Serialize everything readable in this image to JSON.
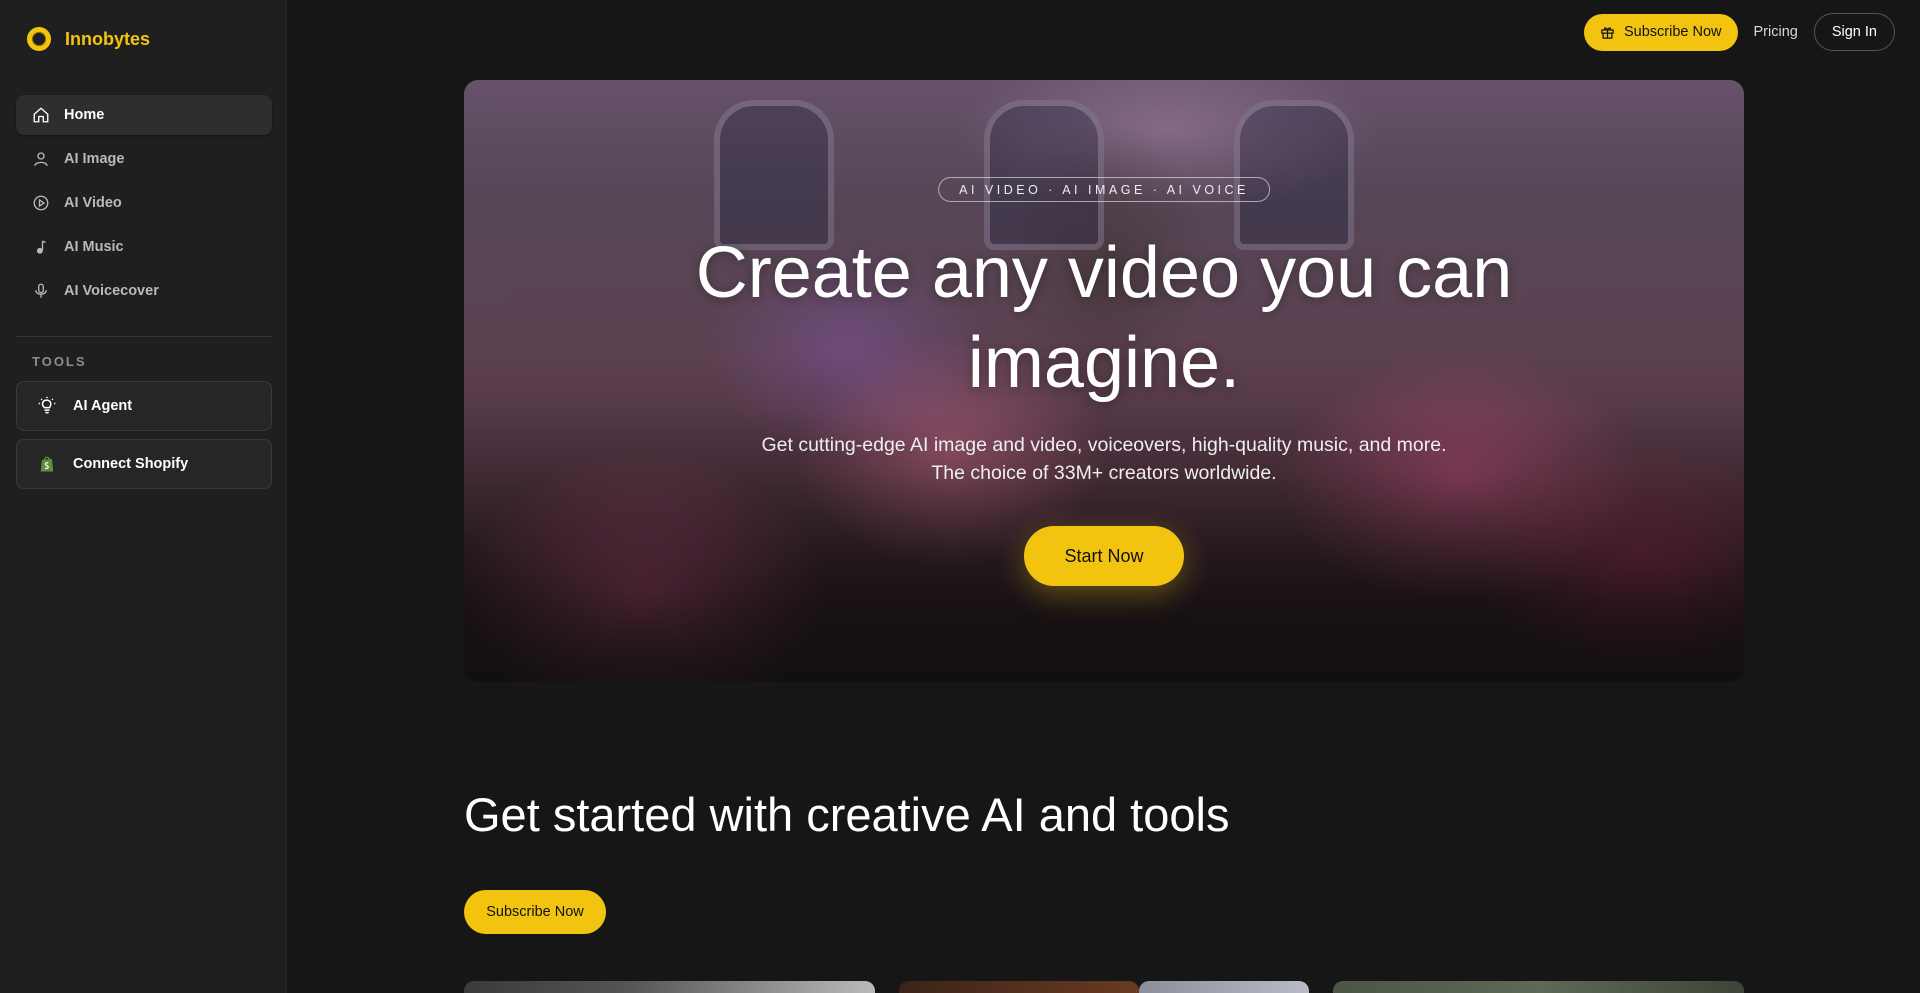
{
  "brand": {
    "name": "Innobytes",
    "accent": "#f2c40f"
  },
  "sidebar": {
    "items": [
      {
        "label": "Home",
        "icon": "home-icon",
        "active": true
      },
      {
        "label": "AI Image",
        "icon": "person-icon",
        "active": false
      },
      {
        "label": "AI Video",
        "icon": "play-circle-icon",
        "active": false
      },
      {
        "label": "AI Music",
        "icon": "music-note-icon",
        "active": false
      },
      {
        "label": "AI Voicecover",
        "icon": "microphone-icon",
        "active": false
      }
    ],
    "tools_label": "TOOLS",
    "tools": [
      {
        "label": "AI Agent",
        "icon": "lightbulb-icon"
      },
      {
        "label": "Connect Shopify",
        "icon": "shopify-icon"
      }
    ]
  },
  "topbar": {
    "subscribe_label": "Subscribe Now",
    "pricing_label": "Pricing",
    "signin_label": "Sign In"
  },
  "hero": {
    "tag": "AI VIDEO · AI IMAGE · AI VOICE",
    "title": "Create any video you can imagine.",
    "subtitle_line1": "Get cutting-edge AI image and video, voiceovers, high-quality music, and more.",
    "subtitle_line2": "The choice of 33M+ creators worldwide.",
    "cta_label": "Start Now"
  },
  "section": {
    "title": "Get started with creative AI and tools",
    "subscribe_label": "Subscribe Now"
  }
}
